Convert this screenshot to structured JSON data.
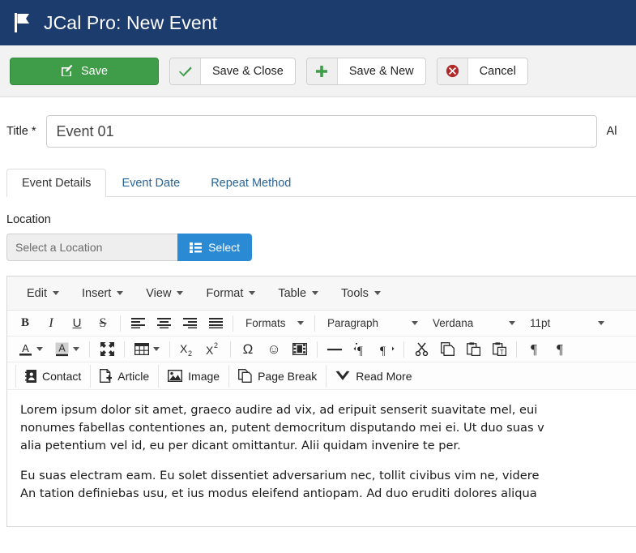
{
  "header": {
    "icon": "flag-icon",
    "title": "JCal Pro: New Event"
  },
  "toolbar": {
    "buttons": [
      {
        "label": "Save",
        "icon": "edit-pencil-icon",
        "style": "primary-green"
      },
      {
        "label": "Save & Close",
        "icon": "check-icon",
        "style": "split"
      },
      {
        "label": "Save & New",
        "icon": "plus-icon",
        "style": "split"
      },
      {
        "label": "Cancel",
        "icon": "cancel-circle-icon",
        "style": "split"
      }
    ]
  },
  "form": {
    "title_label": "Title *",
    "title_value": "Event 01",
    "title_placeholder": "",
    "alias_label": "Al"
  },
  "tabs": [
    {
      "label": "Event Details",
      "active": true
    },
    {
      "label": "Event Date",
      "active": false
    },
    {
      "label": "Repeat Method",
      "active": false
    }
  ],
  "location": {
    "label": "Location",
    "input_value": "Select a Location",
    "button_label": "Select",
    "button_icon": "list-icon"
  },
  "editor": {
    "menubar": [
      "Edit",
      "Insert",
      "View",
      "Format",
      "Table",
      "Tools"
    ],
    "toolbar_row1": [
      {
        "name": "bold-icon",
        "glyph": "B"
      },
      {
        "name": "italic-icon",
        "glyph": "I"
      },
      {
        "name": "underline-icon",
        "glyph": "U"
      },
      {
        "name": "strikethrough-icon",
        "glyph": "S"
      },
      {
        "name": "align-left-icon"
      },
      {
        "name": "align-center-icon"
      },
      {
        "name": "align-right-icon"
      },
      {
        "name": "align-justify-icon"
      }
    ],
    "formats_label": "Formats",
    "block_format": "Paragraph",
    "font_family": "Verdana",
    "font_size": "11pt",
    "toolbar_row2": [
      {
        "name": "text-color-icon"
      },
      {
        "name": "background-color-icon"
      },
      {
        "name": "fullscreen-icon"
      },
      {
        "name": "table-icon"
      },
      {
        "name": "subscript-icon"
      },
      {
        "name": "superscript-icon"
      },
      {
        "name": "special-character-icon",
        "glyph": "Ω"
      },
      {
        "name": "emoticon-icon",
        "glyph": "☺"
      },
      {
        "name": "media-icon"
      },
      {
        "name": "horizontal-rule-icon"
      },
      {
        "name": "ltr-icon"
      },
      {
        "name": "rtl-icon"
      },
      {
        "name": "cut-icon"
      },
      {
        "name": "copy-icon"
      },
      {
        "name": "paste-icon"
      },
      {
        "name": "paste-as-text-icon"
      },
      {
        "name": "show-blocks-icon"
      },
      {
        "name": "visual-aid-icon"
      }
    ],
    "xtd_buttons": [
      {
        "label": "Contact",
        "icon": "contact-icon"
      },
      {
        "label": "Article",
        "icon": "article-icon"
      },
      {
        "label": "Image",
        "icon": "image-icon"
      },
      {
        "label": "Page Break",
        "icon": "page-break-icon"
      },
      {
        "label": "Read More",
        "icon": "read-more-icon"
      }
    ],
    "content_paragraphs": [
      "Lorem ipsum dolor sit amet, graeco audire ad vix, ad eripuit senserit suavitate mel, eui nonumes fabellas contentiones an, putent democritum disputando mei ei. Ut duo suas v alia petentium vel id, eu per dicant omittantur. Alii quidam invenire te per.",
      "Eu suas electram eam. Eu solet dissentiet adversarium nec, tollit civibus vim ne, videre An tation definiebas usu, et ius modus eleifend antiopam. Ad duo eruditi dolores aliqua"
    ],
    "content_line1": "Lorem ipsum dolor sit amet, graeco audire ad vix, ad eripuit senserit suavitate mel, eui",
    "content_line2": "nonumes fabellas contentiones an, putent democritum disputando mei ei. Ut duo suas v",
    "content_line3": "alia petentium vel id, eu per dicant omittantur. Alii quidam invenire te per.",
    "content_line4": "Eu suas electram eam. Eu solet dissentiet adversarium nec, tollit civibus vim ne, videre",
    "content_line5": "An tation definiebas usu, et ius modus eleifend antiopam. Ad duo eruditi dolores aliqua"
  },
  "colors": {
    "header_bg": "#1d3c6e",
    "save_green": "#3f9c48",
    "select_blue": "#2a8ad4",
    "tab_link": "#2a6496",
    "cancel_red": "#b02a2a"
  }
}
